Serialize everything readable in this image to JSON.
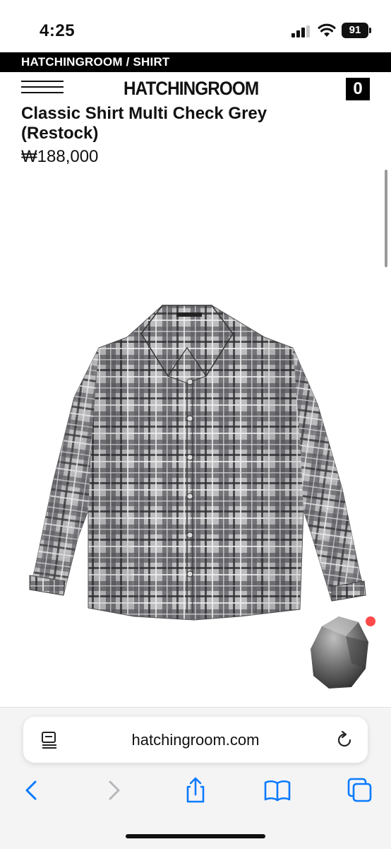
{
  "status": {
    "time": "4:25",
    "battery": "91"
  },
  "breadcrumb": "HATCHINGROOM / SHIRT",
  "header": {
    "logo": "HATCHINGROOM",
    "cart_count": "0"
  },
  "product": {
    "title": "Classic Shirt Multi Check Grey (Restock)",
    "price": "₩188,000",
    "image": "grey-multi-check-shirt"
  },
  "browser": {
    "url": "hatchingroom.com"
  },
  "icons": {
    "menu": "hamburger-menu-icon",
    "reader": "reader-mode-icon",
    "reload": "reload-icon",
    "back": "back-arrow-icon",
    "forward": "forward-arrow-icon",
    "share": "share-icon",
    "bookmarks": "book-icon",
    "tabs": "tabs-icon"
  },
  "colors": {
    "accent": "#0a7aff",
    "notification": "#ff4a4a",
    "brand": "#000000"
  }
}
